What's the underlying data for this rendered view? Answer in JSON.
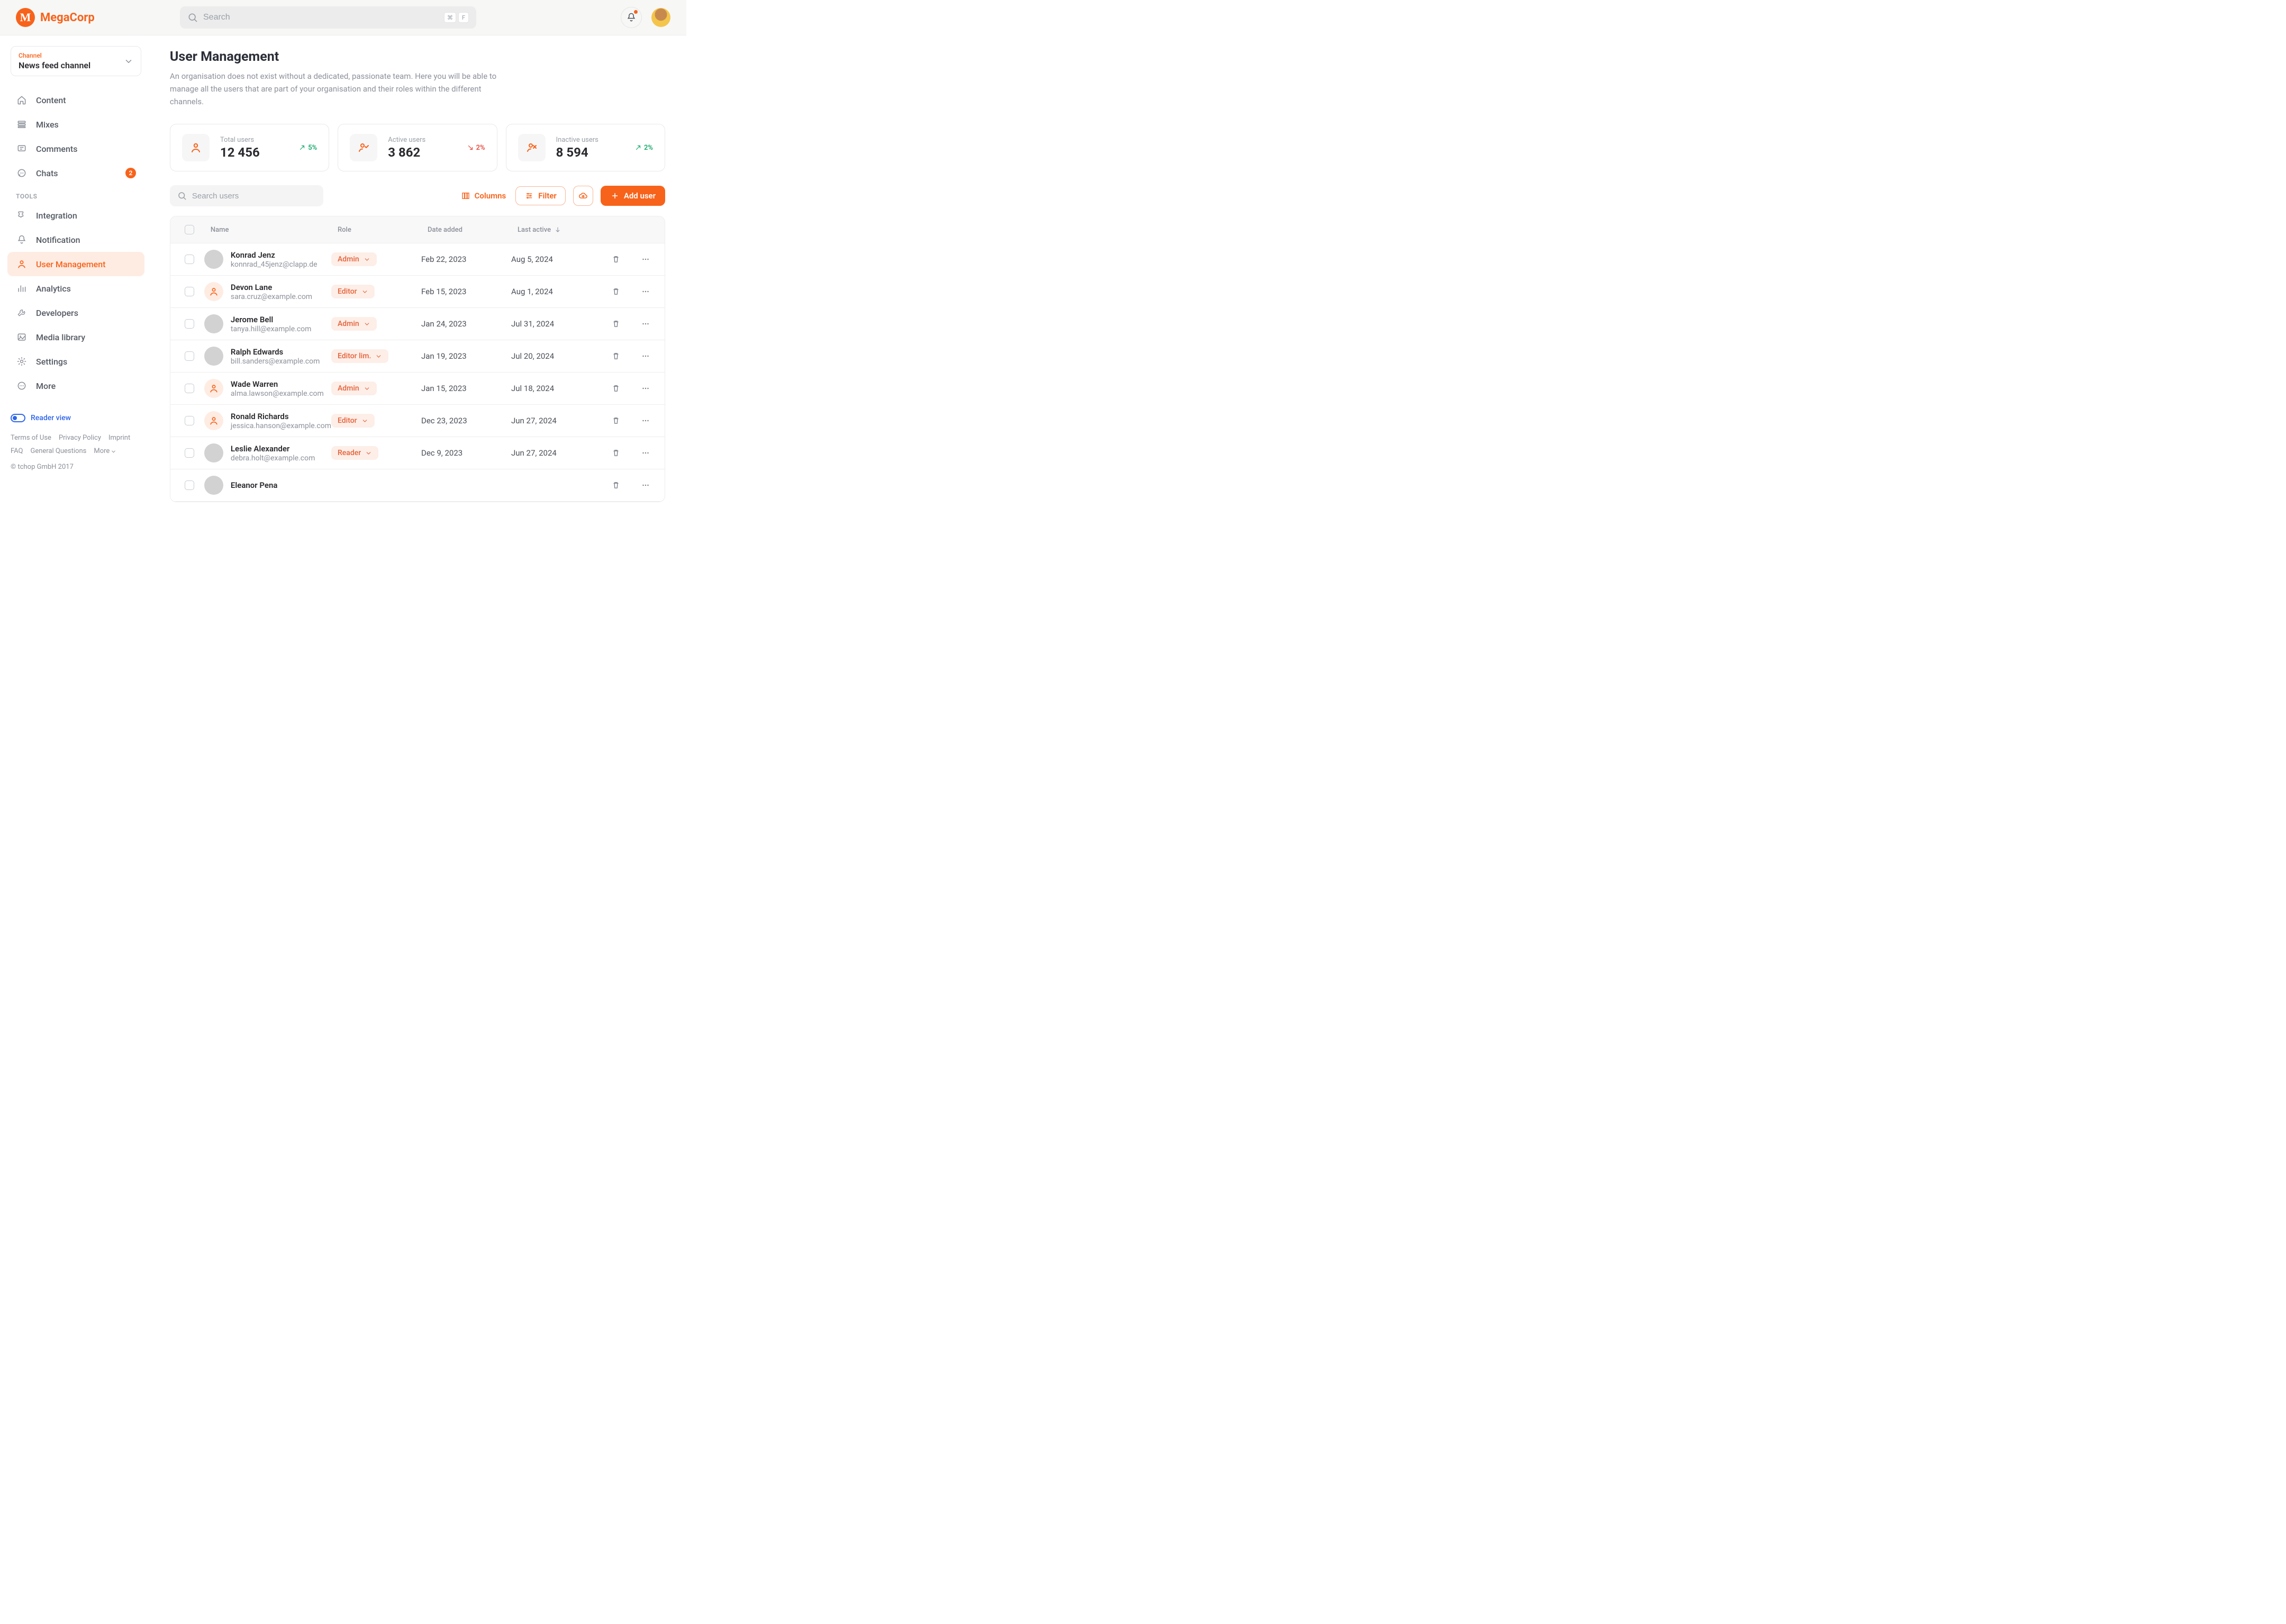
{
  "brand": {
    "name": "MegaCorp",
    "logo_letter": "M"
  },
  "topbar": {
    "search_placeholder": "Search",
    "kbd1": "⌘",
    "kbd2": "F"
  },
  "sidebar": {
    "channel_label": "Channel",
    "channel_value": "News feed channel",
    "main_items": [
      {
        "id": "content",
        "label": "Content",
        "icon": "home",
        "badge": null
      },
      {
        "id": "mixes",
        "label": "Mixes",
        "icon": "rows",
        "badge": null
      },
      {
        "id": "comments",
        "label": "Comments",
        "icon": "comment",
        "badge": null
      },
      {
        "id": "chats",
        "label": "Chats",
        "icon": "chat",
        "badge": "2"
      }
    ],
    "tools_label": "TOOLS",
    "tools_items": [
      {
        "id": "integration",
        "label": "Integration",
        "icon": "puzzle"
      },
      {
        "id": "notification",
        "label": "Notification",
        "icon": "bell"
      },
      {
        "id": "user-management",
        "label": "User Management",
        "icon": "user",
        "active": true
      },
      {
        "id": "analytics",
        "label": "Analytics",
        "icon": "chart"
      },
      {
        "id": "developers",
        "label": "Developers",
        "icon": "wrench"
      },
      {
        "id": "media-library",
        "label": "Media library",
        "icon": "image"
      },
      {
        "id": "settings",
        "label": "Settings",
        "icon": "gear"
      },
      {
        "id": "more",
        "label": "More",
        "icon": "dots"
      }
    ],
    "reader_view": "Reader view",
    "footer_links_row1": [
      "Terms of Use",
      "Privacy Policy",
      "Imprint"
    ],
    "footer_links_row2": [
      "FAQ",
      "General Questions",
      "More "
    ],
    "copyright": "© tchop GmbH 2017"
  },
  "page": {
    "title": "User Management",
    "subtitle": "An organisation does not exist without a dedicated, passionate team. Here you will be able to manage all the users that are part of your organisation and their roles within the different channels."
  },
  "stats": [
    {
      "id": "total",
      "label": "Total users",
      "value": "12 456",
      "trend": "5%",
      "dir": "up",
      "icon": "user"
    },
    {
      "id": "active",
      "label": "Active users",
      "value": "3 862",
      "trend": "2%",
      "dir": "down",
      "icon": "user-check"
    },
    {
      "id": "inactive",
      "label": "Inactive users",
      "value": "8 594",
      "trend": "2%",
      "dir": "up",
      "icon": "user-x"
    }
  ],
  "toolbar": {
    "search_users_placeholder": "Search users",
    "columns_label": "Columns",
    "filter_label": "Filter",
    "add_user_label": "Add user"
  },
  "table": {
    "columns": {
      "name": "Name",
      "role": "Role",
      "date_added": "Date added",
      "last_active": "Last active"
    },
    "rows": [
      {
        "name": "Konrad Jenz",
        "email": "konnrad_45jenz@clapp.de",
        "role": "Admin",
        "date_added": "Feb 22, 2023",
        "last_active": "Aug 5, 2024",
        "avatar": "photo"
      },
      {
        "name": "Devon Lane",
        "email": "sara.cruz@example.com",
        "role": "Editor",
        "date_added": "Feb 15, 2023",
        "last_active": "Aug 1, 2024",
        "avatar": "placeholder"
      },
      {
        "name": "Jerome Bell",
        "email": "tanya.hill@example.com",
        "role": "Admin",
        "date_added": "Jan 24, 2023",
        "last_active": "Jul 31, 2024",
        "avatar": "photo"
      },
      {
        "name": "Ralph Edwards",
        "email": "bill.sanders@example.com",
        "role": "Editor lim.",
        "date_added": "Jan 19, 2023",
        "last_active": "Jul 20, 2024",
        "avatar": "photo"
      },
      {
        "name": "Wade Warren",
        "email": "alma.lawson@example.com",
        "role": "Admin",
        "date_added": "Jan 15, 2023",
        "last_active": "Jul 18, 2024",
        "avatar": "placeholder"
      },
      {
        "name": "Ronald Richards",
        "email": "jessica.hanson@example.com",
        "role": "Editor",
        "date_added": "Dec 23, 2023",
        "last_active": "Jun 27, 2024",
        "avatar": "placeholder"
      },
      {
        "name": "Leslie Alexander",
        "email": "debra.holt@example.com",
        "role": "Reader",
        "date_added": "Dec 9, 2023",
        "last_active": "Jun 27, 2024",
        "avatar": "photo"
      },
      {
        "name": "Eleanor Pena",
        "email": "",
        "role": "",
        "date_added": "",
        "last_active": "",
        "avatar": "photo"
      }
    ]
  }
}
